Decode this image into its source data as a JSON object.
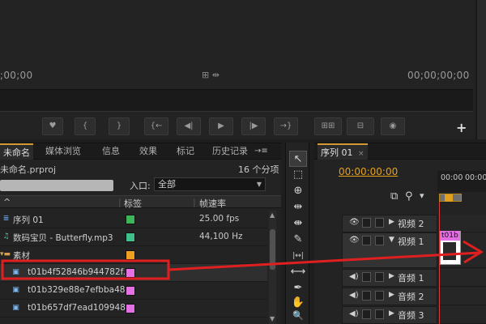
{
  "monitor": {
    "timecode_left": ";00;00",
    "timecode_right": "00;00;00;00",
    "mid_icons": "⊞ ⇹"
  },
  "transport": {
    "buttons": [
      "♥",
      "{",
      "}",
      "{←",
      "◀|",
      "▶",
      "|▶",
      "→}",
      "⊞⊞",
      "⊟",
      "◉"
    ],
    "add_label": "+"
  },
  "project": {
    "tabs": [
      "未命名",
      "媒体浏览",
      "信息",
      "效果",
      "标记",
      "历史记录"
    ],
    "tab_menu_icon": "→≡",
    "project_name": "未命名.prproj",
    "item_count": "16 个分项",
    "entry_label": "入口:",
    "entry_value": "全部",
    "columns": {
      "name": "^",
      "label": "标签",
      "rate": "帧速率"
    },
    "rows": [
      {
        "name": "序列 01",
        "icon": "seq",
        "color": "#3fb55a",
        "rate": "25.00 fps"
      },
      {
        "name": "数码宝贝 - Butterfly.mp3",
        "icon": "audio",
        "color": "#3fbf8a",
        "rate": "44,100 Hz"
      },
      {
        "name": "素材",
        "icon": "folder",
        "color": "#f0a020",
        "rate": ""
      },
      {
        "name": "t01b4f52846b944782f.j",
        "icon": "image",
        "color": "#e470e4",
        "rate": ""
      },
      {
        "name": "t01b329e88e7efbba48.",
        "icon": "image",
        "color": "#e470e4",
        "rate": ""
      },
      {
        "name": "t01b657df7ead109948.",
        "icon": "image",
        "color": "#e470e4",
        "rate": ""
      }
    ]
  },
  "tools": [
    "↖",
    "⬚",
    "⊕",
    "⇹",
    "⇼",
    "✎",
    "|↔|",
    "⟷",
    "✒",
    "✋",
    "🔍"
  ],
  "timeline": {
    "tab": "序列 01",
    "timecode": "00:00:00:00",
    "ruler": [
      "00:00",
      "00:00"
    ],
    "tracks": [
      {
        "name": "视频 2",
        "icon": "👁",
        "tall": false
      },
      {
        "name": "视频 1",
        "icon": "👁",
        "tall": true
      },
      {
        "name": "音频 1",
        "icon": "◀)",
        "tall": false
      },
      {
        "name": "音频 2",
        "icon": "◀)",
        "tall": false
      },
      {
        "name": "音频 3",
        "icon": "◀)",
        "tall": false
      }
    ],
    "clip_label": "t01b"
  },
  "colors": {
    "accent": "#e6a11b",
    "annotation": "#e02020",
    "playhead": "#d43d3d"
  }
}
